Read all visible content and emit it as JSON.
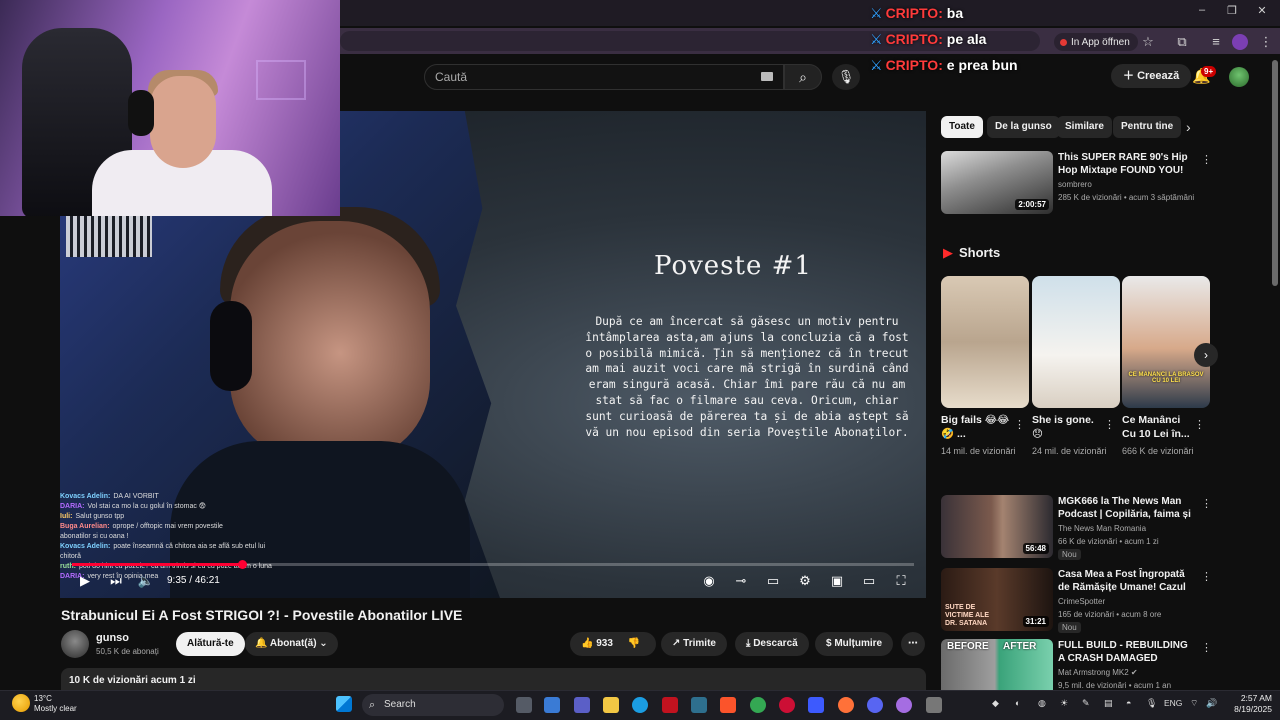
{
  "browser": {
    "in_app_open_label": "In App öffnen",
    "window_controls": [
      "–",
      "❐",
      "✕"
    ]
  },
  "overlay": {
    "crypto_tag": "CRIPTO:",
    "messages": [
      "ba",
      "pe ala",
      "e prea bun"
    ]
  },
  "header": {
    "search_placeholder": "Caută",
    "create_label": "Creează",
    "notification_count": "9+"
  },
  "player": {
    "story": {
      "title": "Poveste #1",
      "text": "După ce am încercat să găsesc un motiv pentru întâmplarea asta,am ajuns la concluzia că a fost o posibilă mimică. Țin să menționez că în trecut am mai auzit voci care mă strigă în surdină când eram singură acasă. Chiar îmi pare rău că nu am stat să fac o filmare sau ceva. Oricum, chiar sunt curioasă de părerea ta și de abia aștept să vă un nou episod din seria Poveștile Abonaților."
    },
    "chat": [
      {
        "name": "Kovacs Adelin:",
        "msg": "DA AI VORBIT",
        "color": "#7fd1ff"
      },
      {
        "name": "DARIA:",
        "msg": "Vol stai ca mo la cu golul în stomac 😨",
        "color": "#b36bff"
      },
      {
        "name": "Iuli:",
        "msg": "Salut gunso tpp",
        "color": "#ffcc66"
      },
      {
        "name": "Buga Aurelian:",
        "msg": "oprope / offtopic mai vrem povestile",
        "color": "#ff8a8a"
      },
      {
        "name": "",
        "msg": "abonatilor si cu oana !",
        "color": "#ddd"
      },
      {
        "name": "Kovacs Adelin:",
        "msg": "poate înseamnă că chitora aia se află sub etul lui",
        "color": "#7fd1ff"
      },
      {
        "name": "",
        "msg": "chitoră",
        "color": "#ddd"
      },
      {
        "name": "ruth:",
        "msg": "poti do hint cu pozele? ca am trimis si eu cu poze acum o luna",
        "color": "#9be39b"
      },
      {
        "name": "DARIA:",
        "msg": "very rest în opinia mea",
        "color": "#b36bff"
      }
    ],
    "time_current": "9:35",
    "time_total": "46:21",
    "time_separator": "/",
    "progress": 0.202
  },
  "video": {
    "title": "Strabunicul Ei A Fost STRIGOI ?! - Povestile Abonatilor LIVE",
    "channel": "gunso",
    "subscribers": "50,5 K de abonați",
    "join_label": "Alătură-te",
    "subscribed_label": "Abonat(ă)",
    "likes": "933",
    "share_label": "Trimite",
    "download_label": "Descarcă",
    "thanks_label": "Mulțumire",
    "views_line": "10 K de vizionări  acum 1 zi"
  },
  "sidebar": {
    "chips": [
      "Toate",
      "De la gunso",
      "Similare",
      "Pentru tine"
    ],
    "top_rec": {
      "title": "This SUPER RARE 90's Hip Hop Mixtape FOUND YOU!",
      "channel": "sombrero",
      "meta": "285 K de vizionări • acum 3 săptămâni",
      "duration": "2:00:57"
    },
    "shorts_label": "Shorts",
    "shorts": [
      {
        "title": "Big fails 😂😂🤣 ...",
        "views": "14 mil. de vizionări"
      },
      {
        "title": "She is gone. 😞",
        "views": "24 mil. de vizionări"
      },
      {
        "title": "Ce Manânci Cu 10 Lei în...",
        "views": "666 K de vizionări"
      }
    ],
    "recs": [
      {
        "title": "MGK666 la The News Man Podcast | Copilăria, faima și ...",
        "channel": "The News Man Romania",
        "meta": "66 K de vizionări • acum 1 zi",
        "duration": "56:48",
        "new": "Nou"
      },
      {
        "title": "Casa Mea a Fost Îngropată de Rămășițe Umane! Cazul Marce...",
        "channel": "CrimeSpotter",
        "meta": "165 de vizionări • acum 8 ore",
        "duration": "31:21",
        "new": "Nou"
      },
      {
        "title": "FULL BUILD - REBUILDING A CRASH DAMAGED MCLAREN ...",
        "channel": "Mat Armstrong MK2 ✔",
        "meta": "9,5 mil. de vizionări • acum 1 an",
        "duration": "",
        "new": ""
      }
    ],
    "thumb_texts": {
      "rec2": "SUTE DE VICTIME ALE DR. SATANA",
      "rec3_before": "BEFORE",
      "rec3_after": "AFTER",
      "short3": "CE MANANCI LA BRASOV CU 10 LEI"
    }
  },
  "taskbar": {
    "temperature": "13°C",
    "weather": "Mostly clear",
    "search_label": "Search",
    "language": "ENG",
    "time": "2:57 AM",
    "date": "8/19/2025"
  }
}
